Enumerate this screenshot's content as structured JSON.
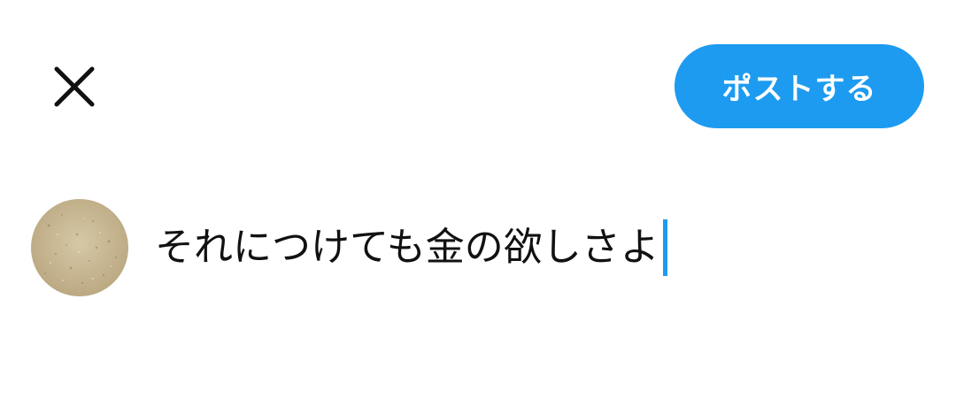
{
  "header": {
    "close_icon": "close-icon",
    "post_button_label": "ポストする",
    "accent_color": "#1d9bf0"
  },
  "compose": {
    "avatar": "user-avatar",
    "text": "それにつけても金の欲しさよ",
    "caret_color": "#1d9bf0"
  }
}
